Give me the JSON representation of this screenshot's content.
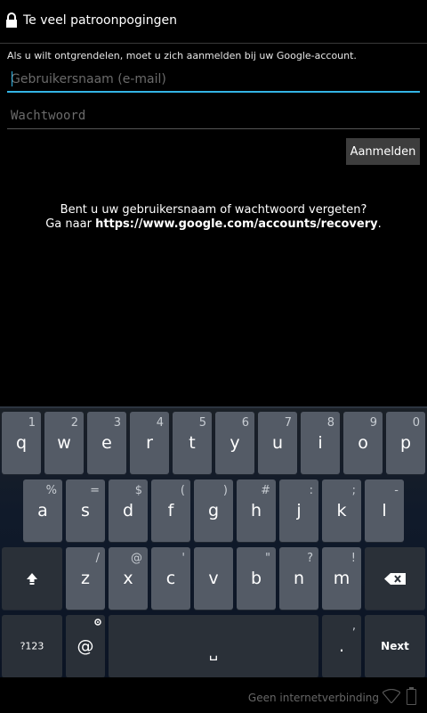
{
  "header": {
    "title": "Te veel patroonpogingen"
  },
  "instructions": "Als u wilt ontgrendelen, moet u zich aanmelden bij uw Google-account.",
  "username": {
    "placeholder": "Gebruikersnaam (e-mail)",
    "value": ""
  },
  "password": {
    "placeholder": "Wachtwoord",
    "value": ""
  },
  "signin_label": "Aanmelden",
  "forgot": {
    "line1": "Bent u uw gebruikersnaam of wachtwoord vergeten?",
    "prefix": "Ga naar ",
    "url": "https://www.google.com/accounts/recovery",
    "suffix": "."
  },
  "keyboard": {
    "row1": [
      {
        "main": "q",
        "hint": "1"
      },
      {
        "main": "w",
        "hint": "2"
      },
      {
        "main": "e",
        "hint": "3"
      },
      {
        "main": "r",
        "hint": "4"
      },
      {
        "main": "t",
        "hint": "5"
      },
      {
        "main": "y",
        "hint": "6"
      },
      {
        "main": "u",
        "hint": "7"
      },
      {
        "main": "i",
        "hint": "8"
      },
      {
        "main": "o",
        "hint": "9"
      },
      {
        "main": "p",
        "hint": "0"
      }
    ],
    "row2": [
      {
        "main": "a",
        "hint": "%"
      },
      {
        "main": "s",
        "hint": "="
      },
      {
        "main": "d",
        "hint": "$"
      },
      {
        "main": "f",
        "hint": "("
      },
      {
        "main": "g",
        "hint": ")"
      },
      {
        "main": "h",
        "hint": "#"
      },
      {
        "main": "j",
        "hint": ":"
      },
      {
        "main": "k",
        "hint": ";"
      },
      {
        "main": "l",
        "hint": "-"
      }
    ],
    "row3": [
      {
        "main": "z",
        "hint": "/"
      },
      {
        "main": "x",
        "hint": "@"
      },
      {
        "main": "c",
        "hint": "'"
      },
      {
        "main": "v",
        "hint": ""
      },
      {
        "main": "b",
        "hint": "\""
      },
      {
        "main": "n",
        "hint": "?"
      },
      {
        "main": "m",
        "hint": "!"
      }
    ],
    "symbols_label": "?123",
    "at_label": "@",
    "space_label": "␣",
    "period_label": ".",
    "period_hint": ",",
    "next_label": "Next"
  },
  "status_bar": {
    "network": "Geen internetverbinding"
  }
}
